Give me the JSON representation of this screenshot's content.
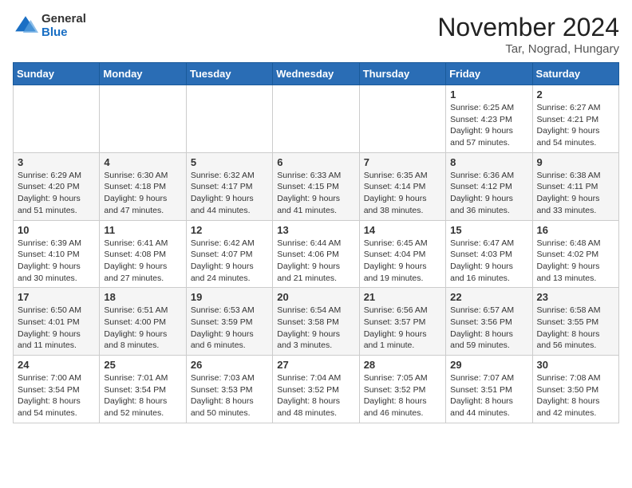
{
  "logo": {
    "general": "General",
    "blue": "Blue"
  },
  "title": {
    "month": "November 2024",
    "location": "Tar, Nograd, Hungary"
  },
  "weekdays": [
    "Sunday",
    "Monday",
    "Tuesday",
    "Wednesday",
    "Thursday",
    "Friday",
    "Saturday"
  ],
  "weeks": [
    [
      {
        "day": "",
        "info": ""
      },
      {
        "day": "",
        "info": ""
      },
      {
        "day": "",
        "info": ""
      },
      {
        "day": "",
        "info": ""
      },
      {
        "day": "",
        "info": ""
      },
      {
        "day": "1",
        "info": "Sunrise: 6:25 AM\nSunset: 4:23 PM\nDaylight: 9 hours\nand 57 minutes."
      },
      {
        "day": "2",
        "info": "Sunrise: 6:27 AM\nSunset: 4:21 PM\nDaylight: 9 hours\nand 54 minutes."
      }
    ],
    [
      {
        "day": "3",
        "info": "Sunrise: 6:29 AM\nSunset: 4:20 PM\nDaylight: 9 hours\nand 51 minutes."
      },
      {
        "day": "4",
        "info": "Sunrise: 6:30 AM\nSunset: 4:18 PM\nDaylight: 9 hours\nand 47 minutes."
      },
      {
        "day": "5",
        "info": "Sunrise: 6:32 AM\nSunset: 4:17 PM\nDaylight: 9 hours\nand 44 minutes."
      },
      {
        "day": "6",
        "info": "Sunrise: 6:33 AM\nSunset: 4:15 PM\nDaylight: 9 hours\nand 41 minutes."
      },
      {
        "day": "7",
        "info": "Sunrise: 6:35 AM\nSunset: 4:14 PM\nDaylight: 9 hours\nand 38 minutes."
      },
      {
        "day": "8",
        "info": "Sunrise: 6:36 AM\nSunset: 4:12 PM\nDaylight: 9 hours\nand 36 minutes."
      },
      {
        "day": "9",
        "info": "Sunrise: 6:38 AM\nSunset: 4:11 PM\nDaylight: 9 hours\nand 33 minutes."
      }
    ],
    [
      {
        "day": "10",
        "info": "Sunrise: 6:39 AM\nSunset: 4:10 PM\nDaylight: 9 hours\nand 30 minutes."
      },
      {
        "day": "11",
        "info": "Sunrise: 6:41 AM\nSunset: 4:08 PM\nDaylight: 9 hours\nand 27 minutes."
      },
      {
        "day": "12",
        "info": "Sunrise: 6:42 AM\nSunset: 4:07 PM\nDaylight: 9 hours\nand 24 minutes."
      },
      {
        "day": "13",
        "info": "Sunrise: 6:44 AM\nSunset: 4:06 PM\nDaylight: 9 hours\nand 21 minutes."
      },
      {
        "day": "14",
        "info": "Sunrise: 6:45 AM\nSunset: 4:04 PM\nDaylight: 9 hours\nand 19 minutes."
      },
      {
        "day": "15",
        "info": "Sunrise: 6:47 AM\nSunset: 4:03 PM\nDaylight: 9 hours\nand 16 minutes."
      },
      {
        "day": "16",
        "info": "Sunrise: 6:48 AM\nSunset: 4:02 PM\nDaylight: 9 hours\nand 13 minutes."
      }
    ],
    [
      {
        "day": "17",
        "info": "Sunrise: 6:50 AM\nSunset: 4:01 PM\nDaylight: 9 hours\nand 11 minutes."
      },
      {
        "day": "18",
        "info": "Sunrise: 6:51 AM\nSunset: 4:00 PM\nDaylight: 9 hours\nand 8 minutes."
      },
      {
        "day": "19",
        "info": "Sunrise: 6:53 AM\nSunset: 3:59 PM\nDaylight: 9 hours\nand 6 minutes."
      },
      {
        "day": "20",
        "info": "Sunrise: 6:54 AM\nSunset: 3:58 PM\nDaylight: 9 hours\nand 3 minutes."
      },
      {
        "day": "21",
        "info": "Sunrise: 6:56 AM\nSunset: 3:57 PM\nDaylight: 9 hours\nand 1 minute."
      },
      {
        "day": "22",
        "info": "Sunrise: 6:57 AM\nSunset: 3:56 PM\nDaylight: 8 hours\nand 59 minutes."
      },
      {
        "day": "23",
        "info": "Sunrise: 6:58 AM\nSunset: 3:55 PM\nDaylight: 8 hours\nand 56 minutes."
      }
    ],
    [
      {
        "day": "24",
        "info": "Sunrise: 7:00 AM\nSunset: 3:54 PM\nDaylight: 8 hours\nand 54 minutes."
      },
      {
        "day": "25",
        "info": "Sunrise: 7:01 AM\nSunset: 3:54 PM\nDaylight: 8 hours\nand 52 minutes."
      },
      {
        "day": "26",
        "info": "Sunrise: 7:03 AM\nSunset: 3:53 PM\nDaylight: 8 hours\nand 50 minutes."
      },
      {
        "day": "27",
        "info": "Sunrise: 7:04 AM\nSunset: 3:52 PM\nDaylight: 8 hours\nand 48 minutes."
      },
      {
        "day": "28",
        "info": "Sunrise: 7:05 AM\nSunset: 3:52 PM\nDaylight: 8 hours\nand 46 minutes."
      },
      {
        "day": "29",
        "info": "Sunrise: 7:07 AM\nSunset: 3:51 PM\nDaylight: 8 hours\nand 44 minutes."
      },
      {
        "day": "30",
        "info": "Sunrise: 7:08 AM\nSunset: 3:50 PM\nDaylight: 8 hours\nand 42 minutes."
      }
    ]
  ]
}
